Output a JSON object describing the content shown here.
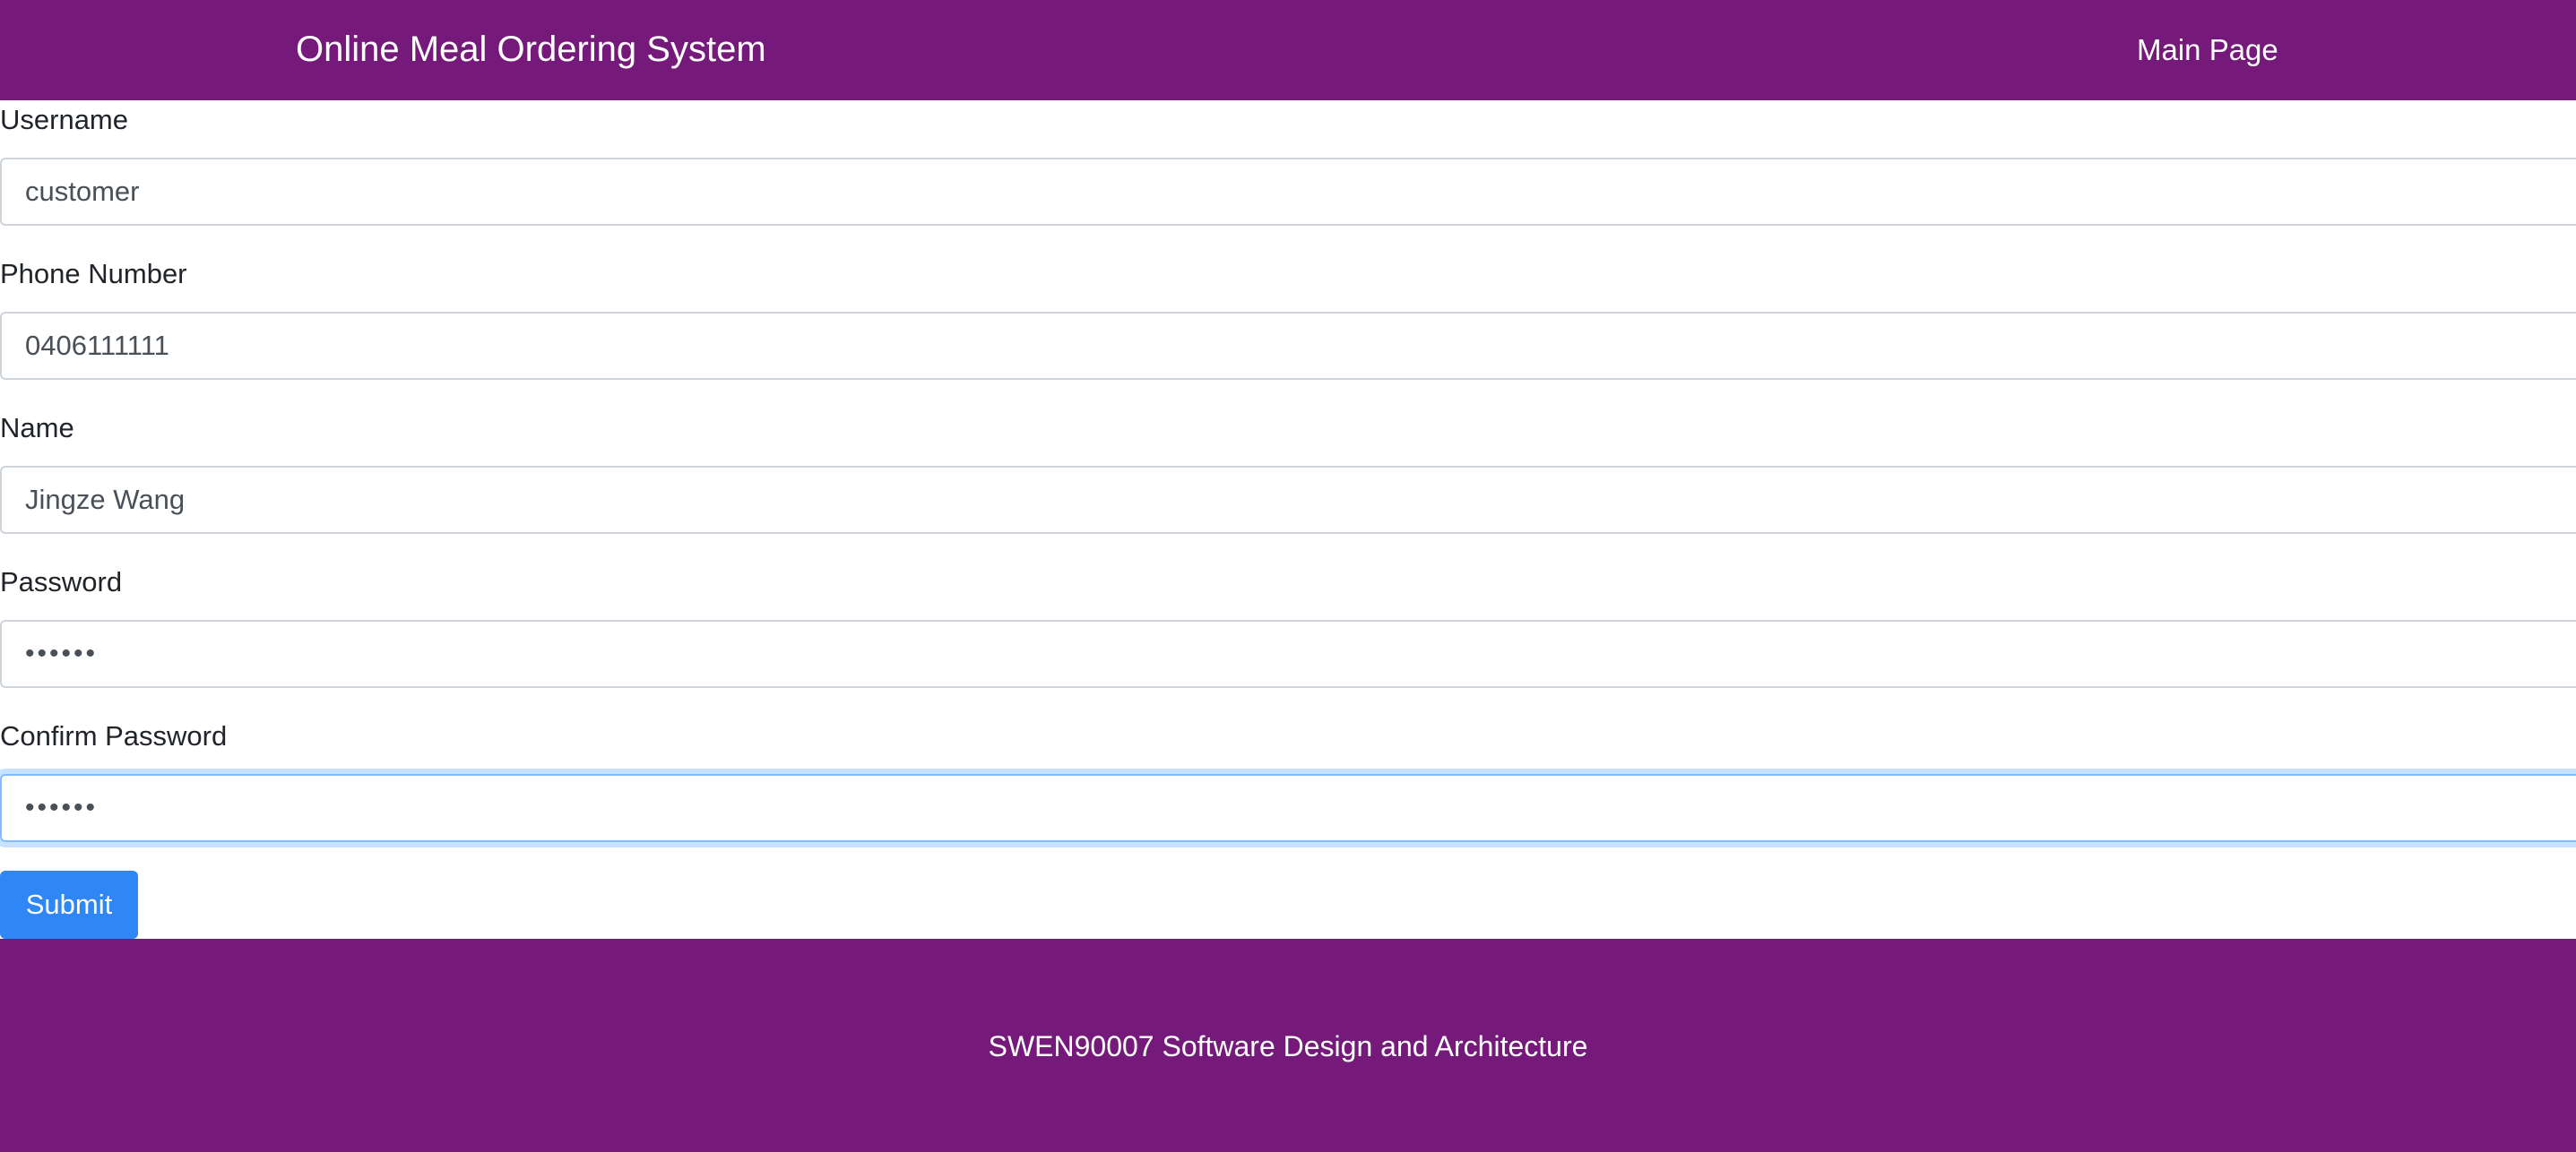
{
  "header": {
    "title": "Online Meal Ordering System",
    "nav_link": "Main Page"
  },
  "form": {
    "username": {
      "label": "Username",
      "value": "customer"
    },
    "phone": {
      "label": "Phone Number",
      "value": "0406111111"
    },
    "name": {
      "label": "Name",
      "value": "Jingze Wang"
    },
    "password": {
      "label": "Password",
      "value": "••••••"
    },
    "confirm_password": {
      "label": "Confirm Password",
      "value": "••••••"
    },
    "submit_label": "Submit"
  },
  "footer": {
    "text": "SWEN90007 Software Design and Architecture"
  },
  "colors": {
    "brand_purple": "#75197a",
    "primary_button": "#2f86f5",
    "focus_border": "#80bdff"
  }
}
